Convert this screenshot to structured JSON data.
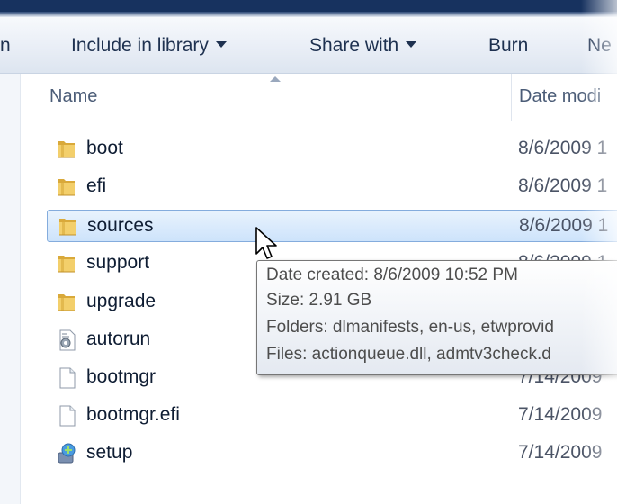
{
  "toolbar": {
    "partial_left": "n",
    "include_label": "Include in library",
    "share_label": "Share with",
    "burn_label": "Burn",
    "new_label": "Ne"
  },
  "columns": {
    "name": "Name",
    "date": "Date modi"
  },
  "files": [
    {
      "name": "boot",
      "date": "8/6/2009 1",
      "icon": "folder-icon"
    },
    {
      "name": "efi",
      "date": "8/6/2009 1",
      "icon": "folder-icon"
    },
    {
      "name": "sources",
      "date": "8/6/2009 1",
      "icon": "folder-icon",
      "selected": true
    },
    {
      "name": "support",
      "date": "8/6/2009 1",
      "icon": "folder-icon"
    },
    {
      "name": "upgrade",
      "date": "",
      "icon": "folder-icon"
    },
    {
      "name": "autorun",
      "date": "",
      "icon": "autorun-icon"
    },
    {
      "name": "bootmgr",
      "date": "7/14/2009",
      "icon": "file-icon"
    },
    {
      "name": "bootmgr.efi",
      "date": "7/14/2009",
      "icon": "file-icon"
    },
    {
      "name": "setup",
      "date": "7/14/2009",
      "icon": "setup-icon"
    }
  ],
  "tooltip": {
    "date_created": "Date created: 8/6/2009 10:52 PM",
    "size": "Size: 2.91 GB",
    "folders": "Folders: dlmanifests, en-us, etwprovid",
    "files": "Files: actionqueue.dll, admtv3check.d"
  }
}
